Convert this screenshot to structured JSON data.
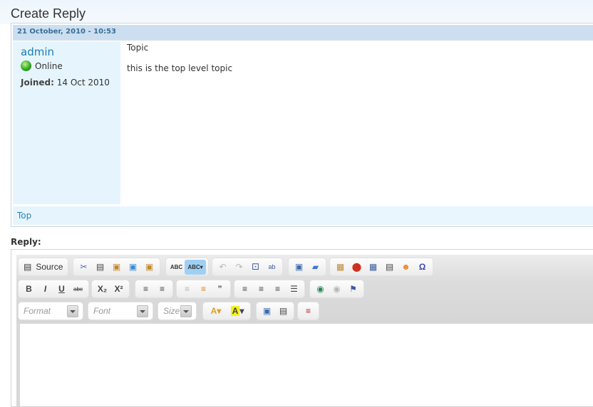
{
  "page": {
    "title": "Create Reply"
  },
  "post": {
    "date": "21 October, 2010 - 10:53",
    "author": "admin",
    "status": "Online",
    "joined_label": "Joined:",
    "joined_value": "14 Oct 2010",
    "subject": "Topic",
    "body": "this is the top level topic",
    "top_link": "Top"
  },
  "reply": {
    "label": "Reply:",
    "toolbar": {
      "source_label": "Source",
      "row1": [
        "cut-icon",
        "copy-icon",
        "paste-icon",
        "paste-text-icon",
        "paste-word-icon",
        "spellcheck-icon",
        "spell-as-you-type-icon",
        "undo-icon",
        "redo-icon",
        "find-icon",
        "replace-icon",
        "select-all-icon",
        "remove-format-icon",
        "image-icon",
        "flash-icon",
        "table-icon",
        "horizontal-rule-icon",
        "smiley-icon",
        "special-char-icon"
      ],
      "row2": [
        "bold-icon",
        "italic-icon",
        "underline-icon",
        "strike-icon",
        "subscript-icon",
        "superscript-icon",
        "numbered-list-icon",
        "bulleted-list-icon",
        "outdent-icon",
        "indent-icon",
        "blockquote-icon",
        "align-left-icon",
        "align-center-icon",
        "align-right-icon",
        "justify-icon",
        "link-icon",
        "unlink-icon",
        "anchor-icon"
      ],
      "format_placeholder": "Format",
      "font_placeholder": "Font",
      "size_placeholder": "Size",
      "row3": [
        "text-color-icon",
        "bg-color-icon",
        "maximize-icon",
        "show-blocks-icon",
        "page-break-icon"
      ]
    },
    "content": ""
  }
}
